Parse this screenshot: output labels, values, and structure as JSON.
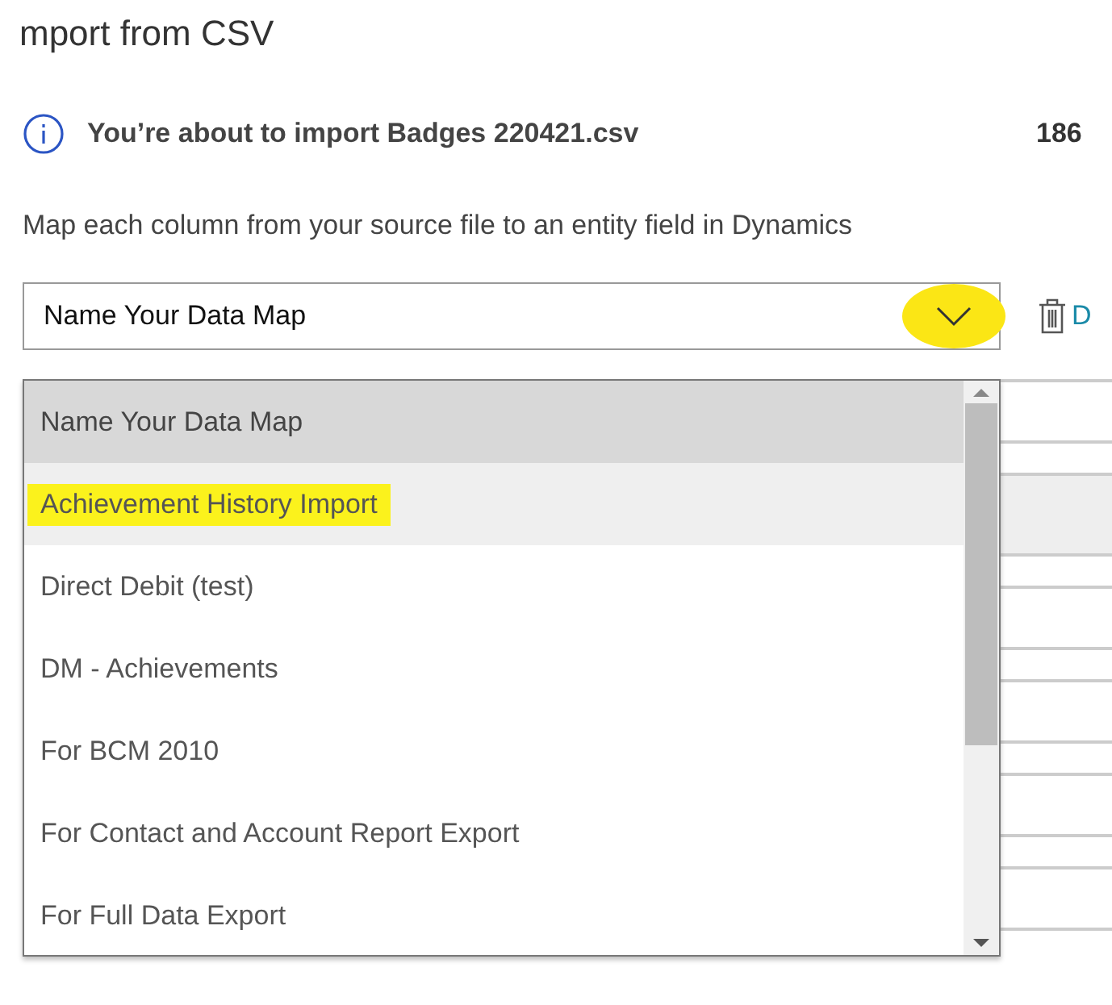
{
  "title": "mport from CSV",
  "info": {
    "message": "You’re about to import Badges 220421.csv",
    "count": "186"
  },
  "description": "Map each column from your source file to an entity field in Dynamics",
  "data_map": {
    "value": "Name Your Data Map",
    "chevron_highlighted": true,
    "expanded": true,
    "options": [
      {
        "label": "Name Your Data Map",
        "selected": true,
        "hovered": false,
        "highlighted": false
      },
      {
        "label": "Achievement History Import",
        "selected": false,
        "hovered": true,
        "highlighted": true
      },
      {
        "label": "Direct Debit (test)",
        "selected": false,
        "hovered": false,
        "highlighted": false
      },
      {
        "label": "DM - Achievements",
        "selected": false,
        "hovered": false,
        "highlighted": false
      },
      {
        "label": "For BCM 2010",
        "selected": false,
        "hovered": false,
        "highlighted": false
      },
      {
        "label": "For Contact and Account Report Export",
        "selected": false,
        "hovered": false,
        "highlighted": false
      },
      {
        "label": "For Full Data Export",
        "selected": false,
        "hovered": false,
        "highlighted": false
      }
    ]
  },
  "delete_link": "D"
}
